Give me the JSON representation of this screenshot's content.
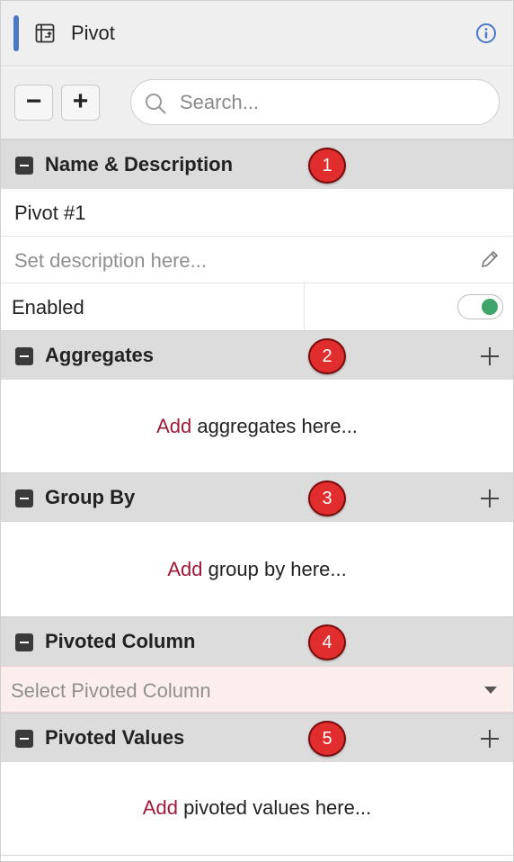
{
  "header": {
    "title": "Pivot",
    "accent_color": "#4a78c9",
    "icons": [
      "pivot-table-icon",
      "info-icon"
    ]
  },
  "toolbar": {
    "collapse_label": "−",
    "expand_label": "+",
    "search_placeholder": "Search..."
  },
  "sections": {
    "name_description": {
      "title": "Name & Description",
      "badge": "1",
      "name_value": "Pivot #1",
      "description_placeholder": "Set description here...",
      "enabled_label": "Enabled",
      "enabled": true
    },
    "aggregates": {
      "title": "Aggregates",
      "badge": "2",
      "add_link": "Add",
      "empty_text": " aggregates here..."
    },
    "group_by": {
      "title": "Group By",
      "badge": "3",
      "add_link": "Add",
      "empty_text": " group by here..."
    },
    "pivoted_column": {
      "title": "Pivoted Column",
      "badge": "4",
      "select_placeholder": "Select Pivoted Column"
    },
    "pivoted_values": {
      "title": "Pivoted Values",
      "badge": "5",
      "add_link": "Add",
      "empty_text": " pivoted values here..."
    }
  },
  "colors": {
    "badge": "#e12d2d",
    "add_link": "#a11a3a",
    "toggle_on": "#3fa56b",
    "select_bg": "#fdeeee"
  }
}
